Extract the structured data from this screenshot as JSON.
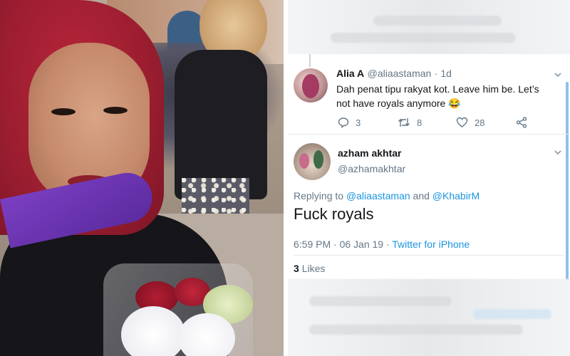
{
  "photo": {
    "subject": "photo"
  },
  "reply_tweet": {
    "display_name": "Alia A",
    "handle": "@aliaastaman",
    "time_ago": "· 1d",
    "text": "Dah penat tipu rakyat kot. Leave him be. Let’s not have royals anymore 😂",
    "reply_count": "3",
    "retweet_count": "8",
    "like_count": "28"
  },
  "main_tweet": {
    "display_name": "azham akhtar",
    "handle": "@azhamakhtar",
    "replying_prefix": "Replying to",
    "reply_user_1": "@aliaastaman",
    "reply_and": "and",
    "reply_user_2": "@KhabirM",
    "text": "Fuck royals",
    "time": "6:59 PM · 06 Jan 19 ·",
    "source": "Twitter for iPhone",
    "likes_count": "3",
    "likes_label": "Likes"
  },
  "colors": {
    "link": "#1b95e0",
    "text_primary": "#14171a",
    "text_secondary": "#657786"
  },
  "icons": {
    "reply": "reply-icon",
    "retweet": "retweet-icon",
    "like": "heart-icon",
    "share": "share-icon",
    "menu": "chevron-down-icon"
  }
}
